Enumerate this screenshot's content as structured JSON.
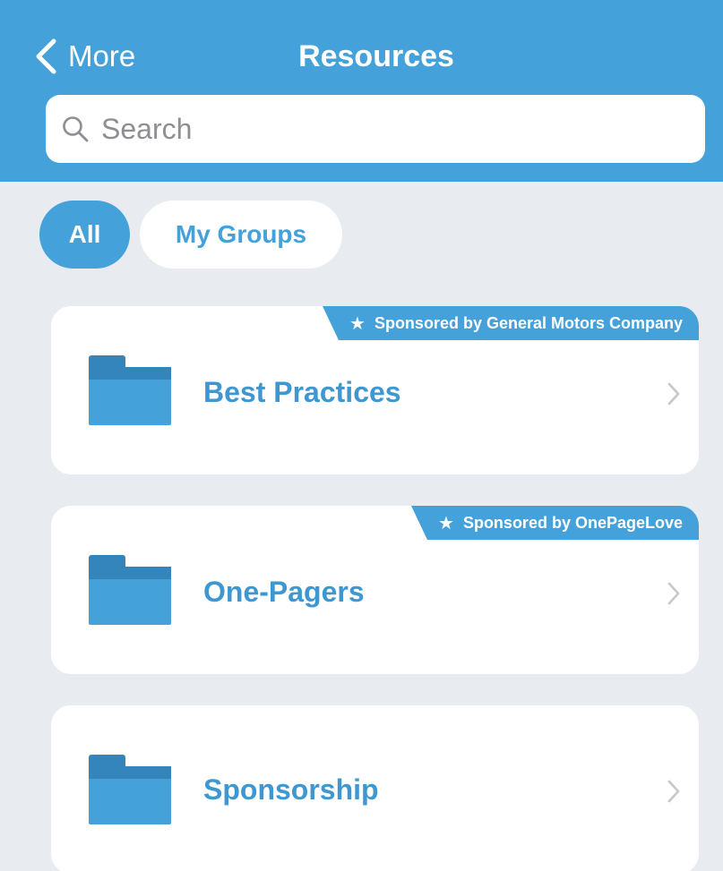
{
  "header": {
    "back_label": "More",
    "title": "Resources"
  },
  "search": {
    "placeholder": "Search"
  },
  "filters": {
    "all_label": "All",
    "my_groups_label": "My Groups",
    "selected": "All"
  },
  "folders": [
    {
      "label": "Best Practices",
      "sponsor": "Sponsored by General Motors Company"
    },
    {
      "label": "One-Pagers",
      "sponsor": "Sponsored by OnePageLove"
    },
    {
      "label": "Sponsorship",
      "sponsor": ""
    }
  ],
  "colors": {
    "accent": "#44a1da",
    "folder_dark": "#3585bd",
    "background": "#e8ecf0",
    "placeholder_gray": "#8e8e93",
    "chevron_gray": "#c7c7cc"
  },
  "icons": {
    "back": "chevron-left-icon",
    "search": "search-icon",
    "star": "star-icon",
    "folder": "folder-icon",
    "disclosure": "chevron-right-icon"
  }
}
